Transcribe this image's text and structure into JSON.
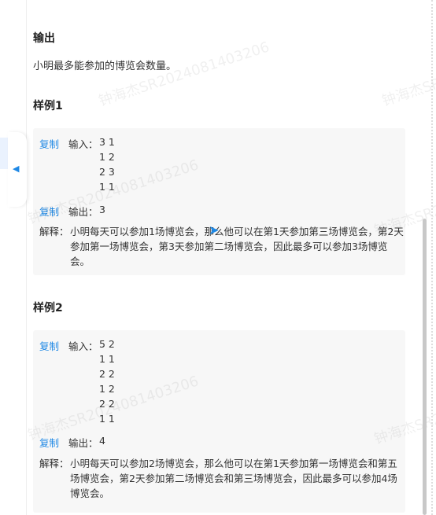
{
  "output_section": {
    "title": "输出",
    "text": "小明最多能参加的博览会数量。"
  },
  "samples": [
    {
      "title": "样例1",
      "copy": "复制",
      "input_label": "输入：",
      "input_lines": [
        "3 1",
        "1 2",
        "2 3",
        "1 1"
      ],
      "output_label": "输出：",
      "output": "3",
      "expl_label": "解释：",
      "expl": "小明每天可以参加1场博览会，那么他可以在第1天参加第三场博览会，第2天参加第一场博览会，第3天参加第二场博览会，因此最多可以参加3场博览会。"
    },
    {
      "title": "样例2",
      "copy": "复制",
      "input_label": "输入：",
      "input_lines": [
        "5 2",
        "1 1",
        "2 2",
        "1 2",
        "2 2",
        "1 1"
      ],
      "output_label": "输出：",
      "output": "4",
      "expl_label": "解释：",
      "expl": "小明每天可以参加2场博览会，那么他可以在第1天参加第一场博览会和第五场博览会，第2天参加第二场博览会和第三场博览会，因此最多可以参加4场博览会。"
    }
  ],
  "watermark": "钟海杰SR2024081403206",
  "accent": "#1e88e5"
}
